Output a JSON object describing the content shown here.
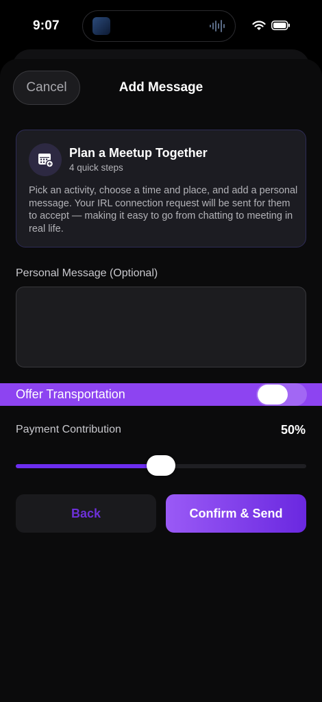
{
  "status_bar": {
    "time": "9:07"
  },
  "header": {
    "cancel_label": "Cancel",
    "title": "Add Message"
  },
  "info_card": {
    "title": "Plan a Meetup Together",
    "subtitle": "4 quick steps",
    "description": "Pick an activity, choose a time and place, and add a personal message. Your IRL connection request will be sent for them to accept — making it easy to go from chatting to meeting in real life.",
    "icon": "calendar-add-icon"
  },
  "personal_message": {
    "label": "Personal Message (Optional)",
    "value": ""
  },
  "transportation": {
    "label": "Offer Transportation",
    "enabled": true
  },
  "payment": {
    "label": "Payment Contribution",
    "value_text": "50%",
    "value": 0.5
  },
  "actions": {
    "back_label": "Back",
    "confirm_label": "Confirm & Send"
  },
  "colors": {
    "accent": "#8d44f1",
    "accent_dark": "#6a28e0",
    "background": "#0b0b0c",
    "card_border": "#2e2c57"
  }
}
